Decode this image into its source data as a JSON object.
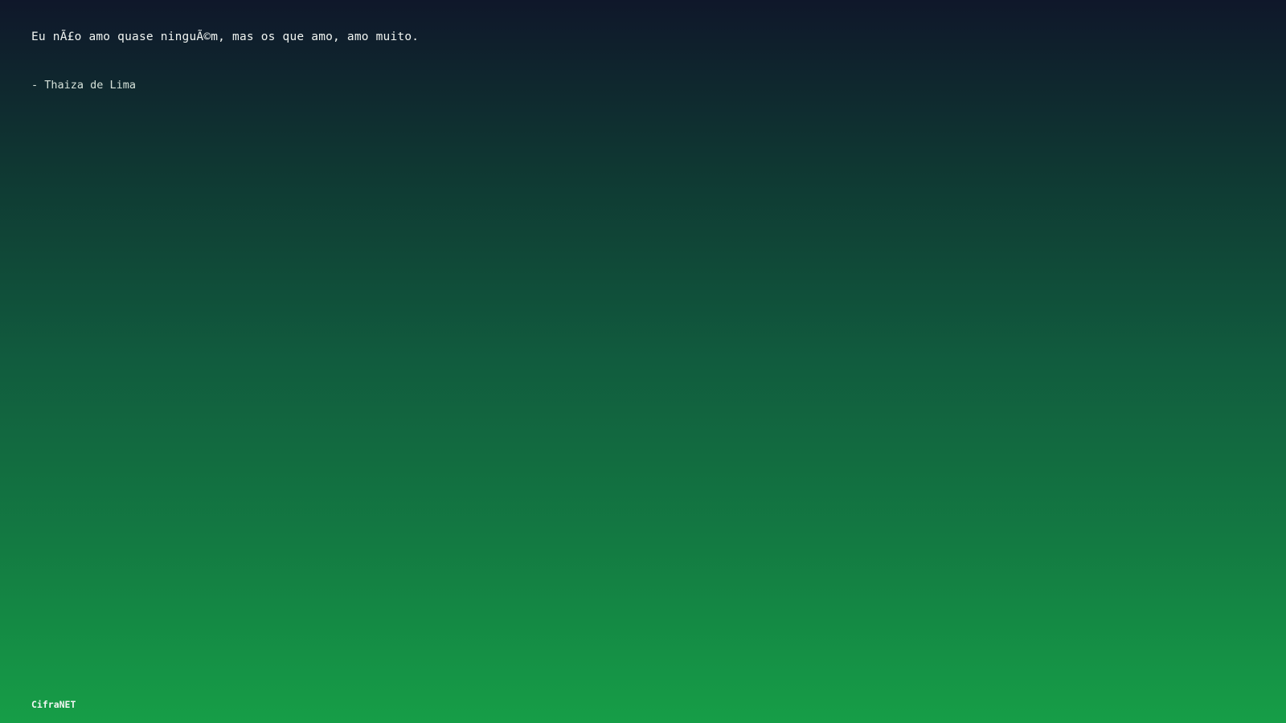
{
  "quote": {
    "text": "Eu nÃ£o amo quase ninguÃ©m, mas os que amo, amo muito.",
    "author": "- Thaiza de Lima"
  },
  "footer": {
    "brand": "CifraNET"
  },
  "colors": {
    "gradient_top": "#0f172a",
    "gradient_bottom": "#169e47",
    "text": "#f1f5f2"
  }
}
